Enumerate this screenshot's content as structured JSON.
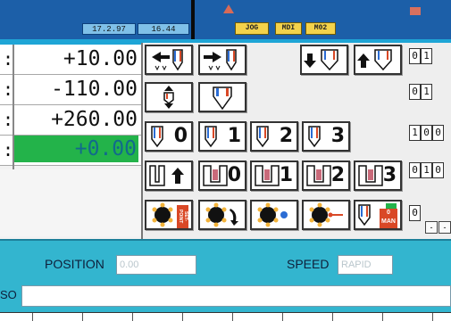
{
  "header": {
    "date": "17.2.97",
    "time": "16.44",
    "modes": [
      "JOG",
      "MDI",
      "M02"
    ]
  },
  "axes": [
    {
      "value": "+10.00",
      "active": false
    },
    {
      "value": "-110.00",
      "active": false
    },
    {
      "value": "+260.00",
      "active": false
    },
    {
      "value": "+0.00",
      "active": true
    }
  ],
  "tools": {
    "numbered": [
      "0",
      "1",
      "2",
      "3"
    ],
    "setpoint_label": "SET-POINT",
    "man_label": "0 MAN"
  },
  "counters": [
    [
      "0",
      "1"
    ],
    [
      "0",
      "1"
    ],
    [
      "1",
      "0",
      "0"
    ],
    [
      "0",
      "1",
      "0"
    ],
    [
      "0"
    ]
  ],
  "mini_buttons": [
    "-",
    "-"
  ],
  "bottom": {
    "position_label": "POSITION",
    "position_value": "0.00",
    "speed_label": "SPEED",
    "speed_value": "RAPID",
    "iso_label": "SO",
    "iso_value": ""
  },
  "colors": {
    "top_bar": "#1c5fa8",
    "band": "#1ea5d6",
    "active_axis": "#23b34a",
    "mode_button": "#f3d24b",
    "bottom_panel": "#33b5cf"
  }
}
